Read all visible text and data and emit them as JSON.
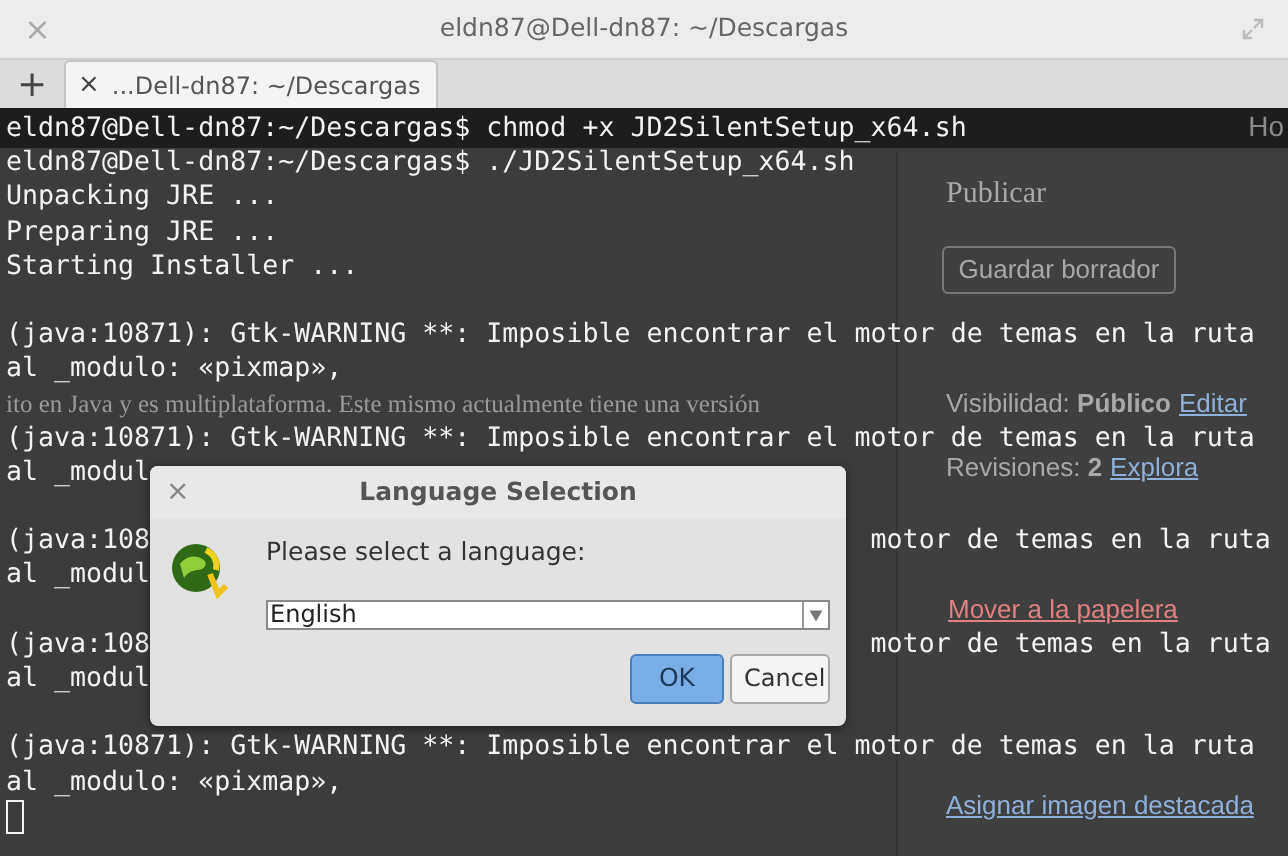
{
  "window": {
    "title": "eldn87@Dell-dn87: ~/Descargas",
    "close": "×",
    "new_tab": "+"
  },
  "tabs": [
    {
      "label": "...Dell-dn87: ~/Descargas",
      "close": "×",
      "selected": true
    }
  ],
  "background_page": {
    "corner": "Ho",
    "body_text": "ito en Java y es multiplataforma. Este mismo actualmente tiene una versión",
    "sidebar": {
      "title": "Publicar",
      "save_button": "Guardar borrador",
      "visibility": {
        "label": "Visibilidad: **Público**",
        "link": "Editar"
      },
      "revisions": {
        "label": "Revisiones: **2**",
        "link": "Explora"
      },
      "trash_link": "Mover a la papelera",
      "image_link": "Asignar imagen destacada"
    }
  },
  "terminal": {
    "lines": [
      {
        "kind": "text",
        "text": "eldn87@Dell-dn87:~/Descargas$ chmod +x JD2SilentSetup_x64.sh"
      },
      {
        "kind": "text",
        "text": "eldn87@Dell-dn87:~/Descargas$ ./JD2SilentSetup_x64.sh"
      },
      {
        "kind": "text",
        "text": "Unpacking JRE ..."
      },
      {
        "kind": "text",
        "text": "Preparing JRE ..."
      },
      {
        "kind": "text",
        "text": "Starting Installer ..."
      },
      {
        "kind": "blank"
      },
      {
        "kind": "text",
        "text": "(java:10871): Gtk-WARNING **: Imposible encontrar el motor de temas en la ruta"
      },
      {
        "kind": "text",
        "text": "al _modulo: «pixmap»,"
      },
      {
        "kind": "blank"
      },
      {
        "kind": "text",
        "text": "(java:10871): Gtk-WARNING **: Imposible encontrar el motor de temas en la ruta"
      },
      {
        "kind": "text",
        "text": "al _modul"
      },
      {
        "kind": "blank"
      },
      {
        "kind": "split",
        "text": "(java:108",
        "right": "motor de temas en la ruta"
      },
      {
        "kind": "text",
        "text": "al _modul"
      },
      {
        "kind": "blank"
      },
      {
        "kind": "split",
        "text": "(java:108",
        "right": "motor de temas en la ruta"
      },
      {
        "kind": "text",
        "text": "al _modul"
      },
      {
        "kind": "blank"
      },
      {
        "kind": "text",
        "text": "(java:10871): Gtk-WARNING **: Imposible encontrar el motor de temas en la ruta"
      },
      {
        "kind": "text",
        "text": "al _modulo: «pixmap»,"
      }
    ],
    "cursor": true
  },
  "dialog": {
    "title": "Language Selection",
    "close": "×",
    "prompt": "Please select a language:",
    "language": "English",
    "buttons": [
      {
        "label": "OK",
        "default": true
      },
      {
        "label": "Cancel",
        "default": false
      }
    ]
  }
}
